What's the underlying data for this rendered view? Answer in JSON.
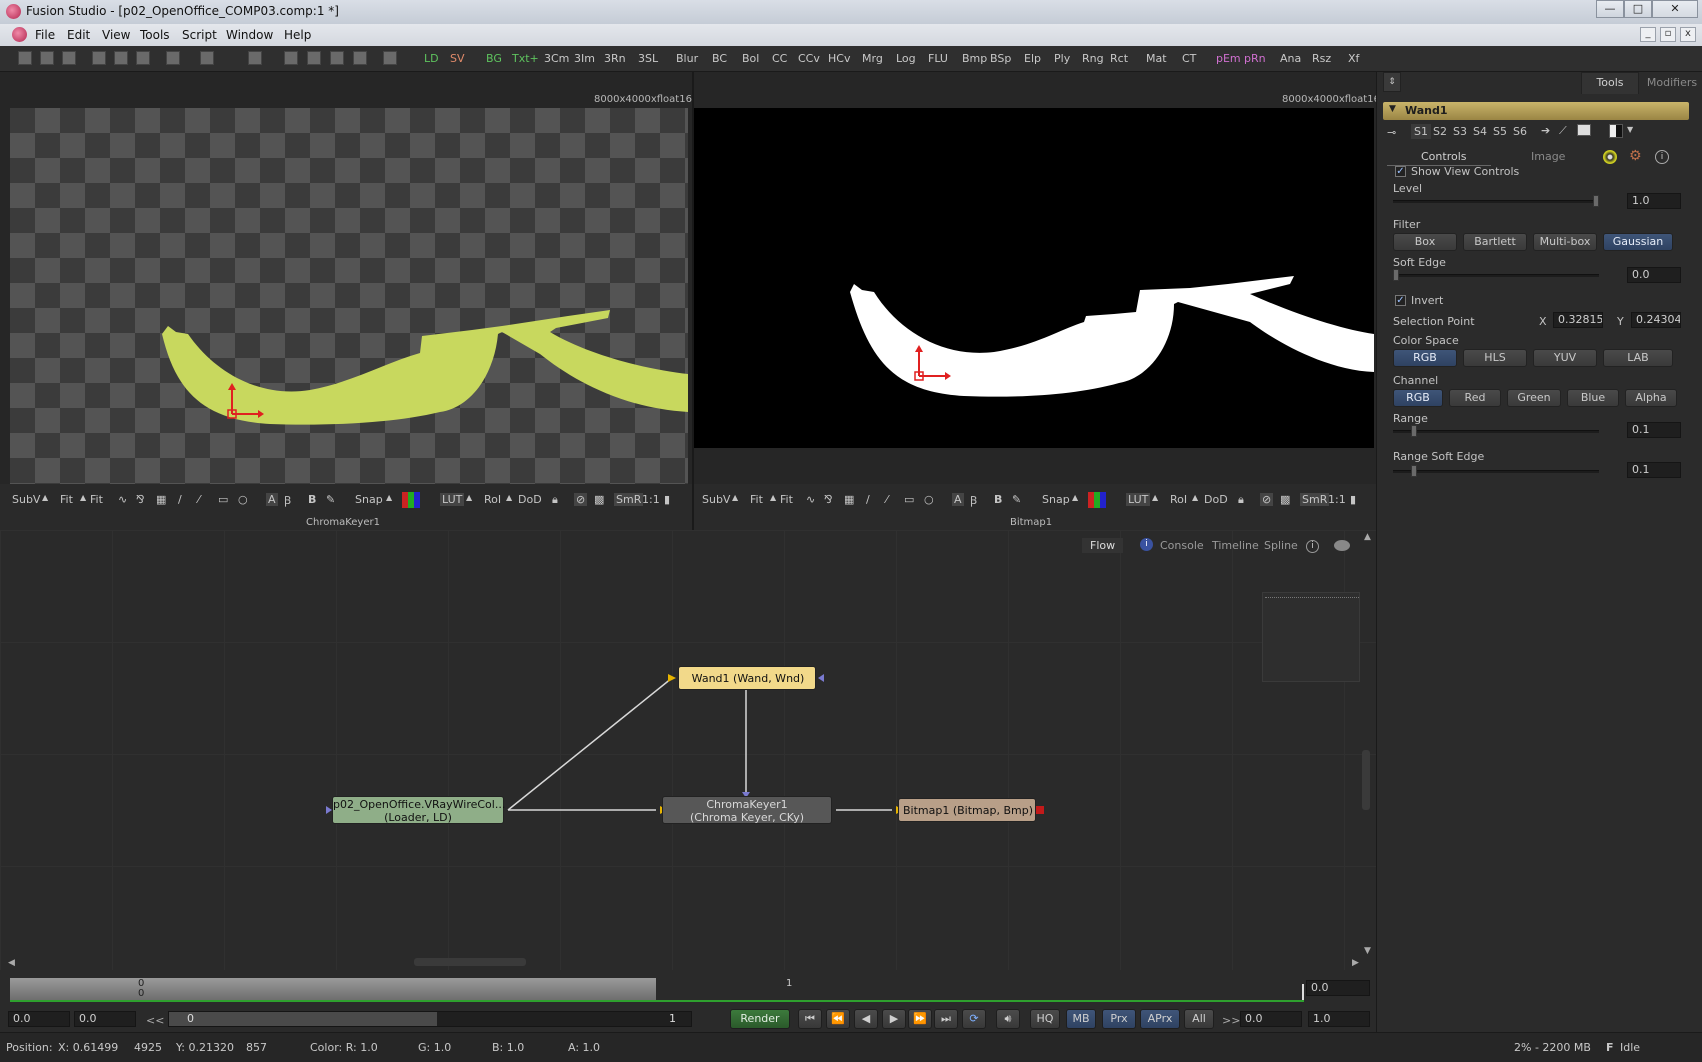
{
  "window": {
    "title": "Fusion Studio - [p02_OpenOffice_COMP03.comp:1 *]"
  },
  "menu": [
    "File",
    "Edit",
    "View",
    "Tools",
    "Script",
    "Window",
    "Help"
  ],
  "toolbar": [
    "LD",
    "SV",
    "BG",
    "Txt+",
    "3Cm",
    "3Im",
    "3Rn",
    "3SL",
    "Blur",
    "BC",
    "Bol",
    "CC",
    "CCv",
    "HCv",
    "Mrg",
    "Log",
    "FLU",
    "Bmp",
    "BSp",
    "Elp",
    "Ply",
    "Rng",
    "Rct",
    "Mat",
    "CT",
    "pEm",
    "pRn",
    "Ana",
    "Rsz",
    "Xf"
  ],
  "viewer_left": {
    "resolution": "8000x4000xfloat16",
    "name": "ChromaKeyer1",
    "tools": [
      "SubV",
      "Fit",
      "Fit",
      "Snap",
      "LUT",
      "RoI",
      "DoD",
      "SmR",
      "1:1"
    ]
  },
  "viewer_right": {
    "resolution": "8000x4000xfloat16",
    "name": "Bitmap1",
    "tools": [
      "SubV",
      "Fit",
      "Fit",
      "Snap",
      "LUT",
      "RoI",
      "DoD",
      "SmR",
      "1:1"
    ]
  },
  "panel": {
    "tabs": [
      "Tools",
      "Modifiers"
    ],
    "tool_name": "Wand1",
    "slots": [
      "S1",
      "S2",
      "S3",
      "S4",
      "S5",
      "S6"
    ],
    "subtabs": [
      "Controls",
      "Image"
    ],
    "show_view_controls": "Show View Controls",
    "level": {
      "label": "Level",
      "value": "1.0",
      "fraction": 1.0
    },
    "filter": {
      "label": "Filter",
      "options": [
        "Box",
        "Bartlett",
        "Multi-box",
        "Gaussian"
      ],
      "selected": "Gaussian"
    },
    "soft_edge": {
      "label": "Soft Edge",
      "value": "0.0",
      "fraction": 0.0
    },
    "invert": "Invert",
    "selection_point": {
      "label": "Selection Point",
      "x_label": "X",
      "x": "0.328150",
      "y_label": "Y",
      "y": "0.243044"
    },
    "color_space": {
      "label": "Color Space",
      "options": [
        "RGB",
        "HLS",
        "YUV",
        "LAB"
      ],
      "selected": "RGB"
    },
    "channel": {
      "label": "Channel",
      "options": [
        "RGB",
        "Red",
        "Green",
        "Blue",
        "Alpha"
      ],
      "selected": "RGB"
    },
    "range": {
      "label": "Range",
      "value": "0.1",
      "fraction": 0.1
    },
    "range_soft_edge": {
      "label": "Range Soft Edge",
      "value": "0.1",
      "fraction": 0.1
    }
  },
  "flow": {
    "tabs": [
      "Flow",
      "Console",
      "Timeline",
      "Spline"
    ],
    "nodes": {
      "wand": "Wand1  (Wand, Wnd)",
      "loader_1": "p02_OpenOffice.VRayWireCol...",
      "loader_2": "(Loader, LD)",
      "chroma_1": "ChromaKeyer1",
      "chroma_2": "(Chroma Keyer, CKy)",
      "bitmap": "Bitmap1  (Bitmap, Bmp)"
    }
  },
  "timeline": {
    "top": "0",
    "bottom": "0",
    "mark": "1",
    "end": "0.0"
  },
  "transport": {
    "start": "0.0",
    "start2": "0.0",
    "rewind": "<<",
    "current": "0",
    "end": "1",
    "render": "Render",
    "buttons": [
      "HQ",
      "MB",
      "Prx",
      "APrx",
      "All"
    ],
    "fwd": ">>",
    "val1": "0.0",
    "val2": "1.0"
  },
  "status": {
    "position": "Position:",
    "x": "X: 0.61499",
    "px": "4925",
    "y": "Y: 0.21320",
    "py": "857",
    "color": "Color: R: 1.0",
    "g": "G: 1.0",
    "b": "B: 1.0",
    "a": "A: 1.0",
    "memory": "2% - 2200 MB",
    "state": "Idle"
  },
  "colors": {
    "accent": "#c9d85f",
    "node_wand": "#f3d98c",
    "node_loader": "#8fb08a",
    "node_chroma": "#585858",
    "node_bitmap": "#b8a08a"
  }
}
